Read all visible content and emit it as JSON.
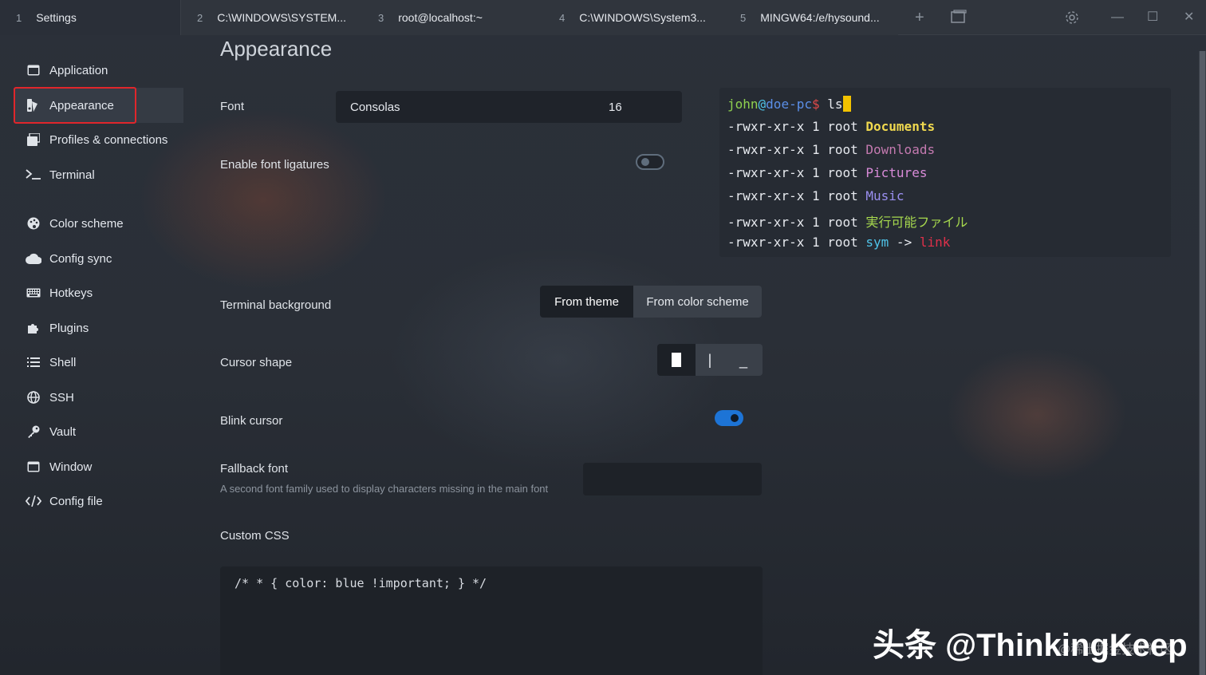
{
  "tabs": [
    {
      "num": "1",
      "label": "Settings"
    },
    {
      "num": "2",
      "label": "C:\\WINDOWS\\SYSTEM..."
    },
    {
      "num": "3",
      "label": "root@localhost:~"
    },
    {
      "num": "4",
      "label": "C:\\WINDOWS\\System3..."
    },
    {
      "num": "5",
      "label": "MINGW64:/e/hysound..."
    }
  ],
  "window_controls": {
    "add": "+",
    "minimize": "—",
    "maximize": "☐",
    "close": "✕"
  },
  "sidebar": {
    "items": [
      {
        "label": "Application",
        "icon": "window-icon"
      },
      {
        "label": "Appearance",
        "icon": "appearance-icon"
      },
      {
        "label": "Profiles & connections",
        "icon": "profiles-icon"
      },
      {
        "label": "Terminal",
        "icon": "terminal-icon"
      },
      {
        "label": "Color scheme",
        "icon": "palette-icon"
      },
      {
        "label": "Config sync",
        "icon": "cloud-icon"
      },
      {
        "label": "Hotkeys",
        "icon": "keyboard-icon"
      },
      {
        "label": "Plugins",
        "icon": "puzzle-icon"
      },
      {
        "label": "Shell",
        "icon": "list-icon"
      },
      {
        "label": "SSH",
        "icon": "globe-icon"
      },
      {
        "label": "Vault",
        "icon": "key-icon"
      },
      {
        "label": "Window",
        "icon": "window-icon"
      },
      {
        "label": "Config file",
        "icon": "code-icon"
      }
    ]
  },
  "main": {
    "title": "Appearance",
    "font": {
      "label": "Font",
      "family": "Consolas",
      "size": "16"
    },
    "ligatures": {
      "label": "Enable font ligatures",
      "enabled": false
    },
    "terminal_background": {
      "label": "Terminal background",
      "options": [
        "From theme",
        "From color scheme"
      ],
      "selected": "From theme"
    },
    "cursor_shape": {
      "label": "Cursor shape",
      "options": [
        "block",
        "beam",
        "underline"
      ],
      "selected": "block",
      "glyphs": [
        "",
        "|",
        "_"
      ]
    },
    "blink_cursor": {
      "label": "Blink cursor",
      "enabled": true
    },
    "fallback_font": {
      "label": "Fallback font",
      "description": "A second font family used to display characters missing in the main font",
      "value": ""
    },
    "custom_css": {
      "label": "Custom CSS",
      "value": "/* * { color: blue !important; } */"
    }
  },
  "preview": {
    "prompt_user": "john",
    "prompt_at": "@",
    "prompt_host": "doe-pc",
    "prompt_symbol": "$",
    "command": " ls",
    "perm": "-rwxr-xr-x 1 root ",
    "entries": [
      {
        "name": "Documents",
        "color": "#f0d94f"
      },
      {
        "name": "Downloads",
        "color": "#c47ab0"
      },
      {
        "name": "Pictures",
        "color": "#d88bd8"
      },
      {
        "name": "Music",
        "color": "#9a8ff0"
      },
      {
        "name": "実行可能ファイル",
        "color": "#a6d84e"
      }
    ],
    "symlink": {
      "name": "sym",
      "arrow": " -> ",
      "target": "link"
    },
    "colors": {
      "user": "#8fd14f",
      "at": "#4fc3e8",
      "host": "#5b8fe8",
      "symbol": "#e04a4a",
      "sym": "#4fc3e8",
      "link": "#e0304a"
    }
  },
  "watermark": {
    "text": "头条 @ThinkingKeep",
    "subtext": "@稀土掘金技术社区"
  },
  "colors": {
    "accent": "#1d74d6",
    "highlight_border": "#e0262b",
    "background": "#262b34"
  }
}
